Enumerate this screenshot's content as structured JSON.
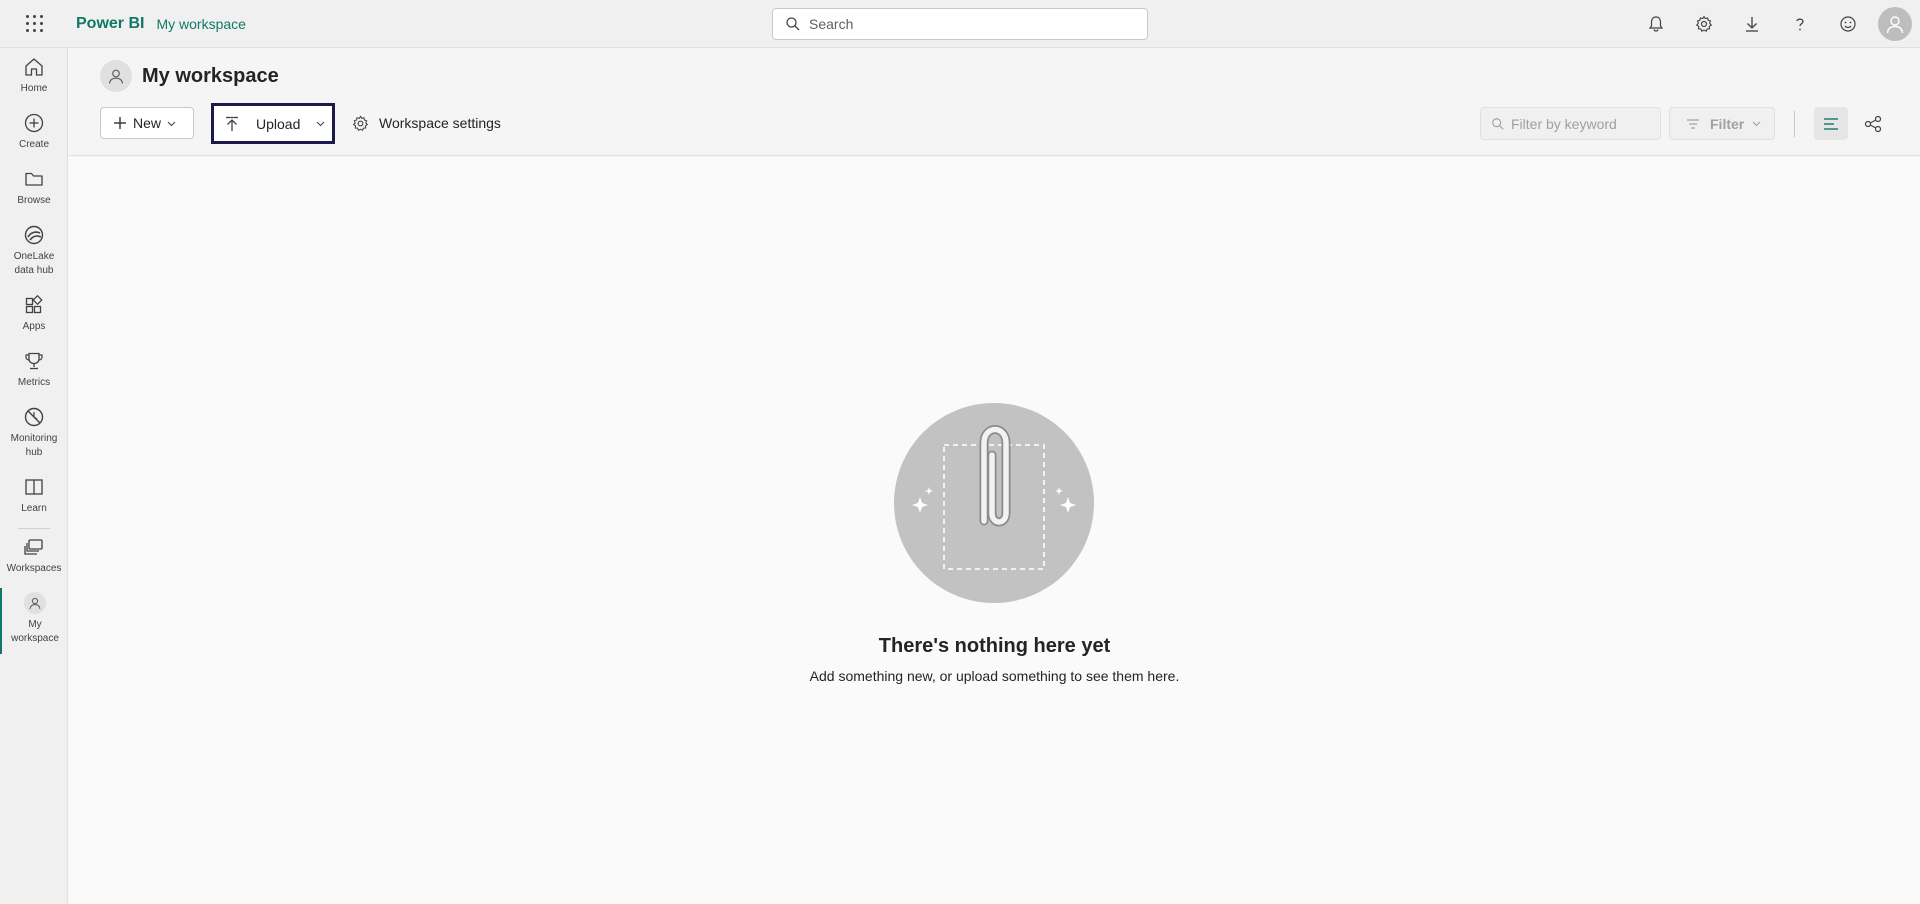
{
  "topbar": {
    "app_name": "Power BI",
    "breadcrumb": "My workspace",
    "search_placeholder": "Search",
    "icons": [
      "bell-icon",
      "gear-icon",
      "download-icon",
      "help-icon",
      "smiley-icon",
      "account-avatar"
    ]
  },
  "leftnav": {
    "items": [
      {
        "label": "Home",
        "icon": "home-icon"
      },
      {
        "label": "Create",
        "icon": "plus-circle-icon"
      },
      {
        "label": "Browse",
        "icon": "folder-icon"
      },
      {
        "label": "OneLake data hub",
        "line1": "OneLake",
        "line2": "data hub",
        "icon": "onelake-icon"
      },
      {
        "label": "Apps",
        "icon": "apps-icon"
      },
      {
        "label": "Metrics",
        "icon": "trophy-icon"
      },
      {
        "label": "Monitoring hub",
        "line1": "Monitoring",
        "line2": "hub",
        "icon": "monitoring-icon"
      },
      {
        "label": "Learn",
        "icon": "book-icon"
      },
      {
        "label": "Workspaces",
        "icon": "workspaces-icon"
      },
      {
        "label": "My workspace",
        "line1": "My",
        "line2": "workspace",
        "icon": "person-icon",
        "active": true
      }
    ]
  },
  "header": {
    "title": "My workspace",
    "new_label": "New",
    "upload_label": "Upload",
    "settings_label": "Workspace settings",
    "filter_placeholder": "Filter by keyword",
    "filter_label": "Filter"
  },
  "empty_state": {
    "title": "There's nothing here yet",
    "subtitle": "Add something new, or upload something to see them here."
  },
  "colors": {
    "brand": "#117865",
    "focus_outline": "#1b1a4a",
    "illustration_bg": "#c2c2c2"
  }
}
